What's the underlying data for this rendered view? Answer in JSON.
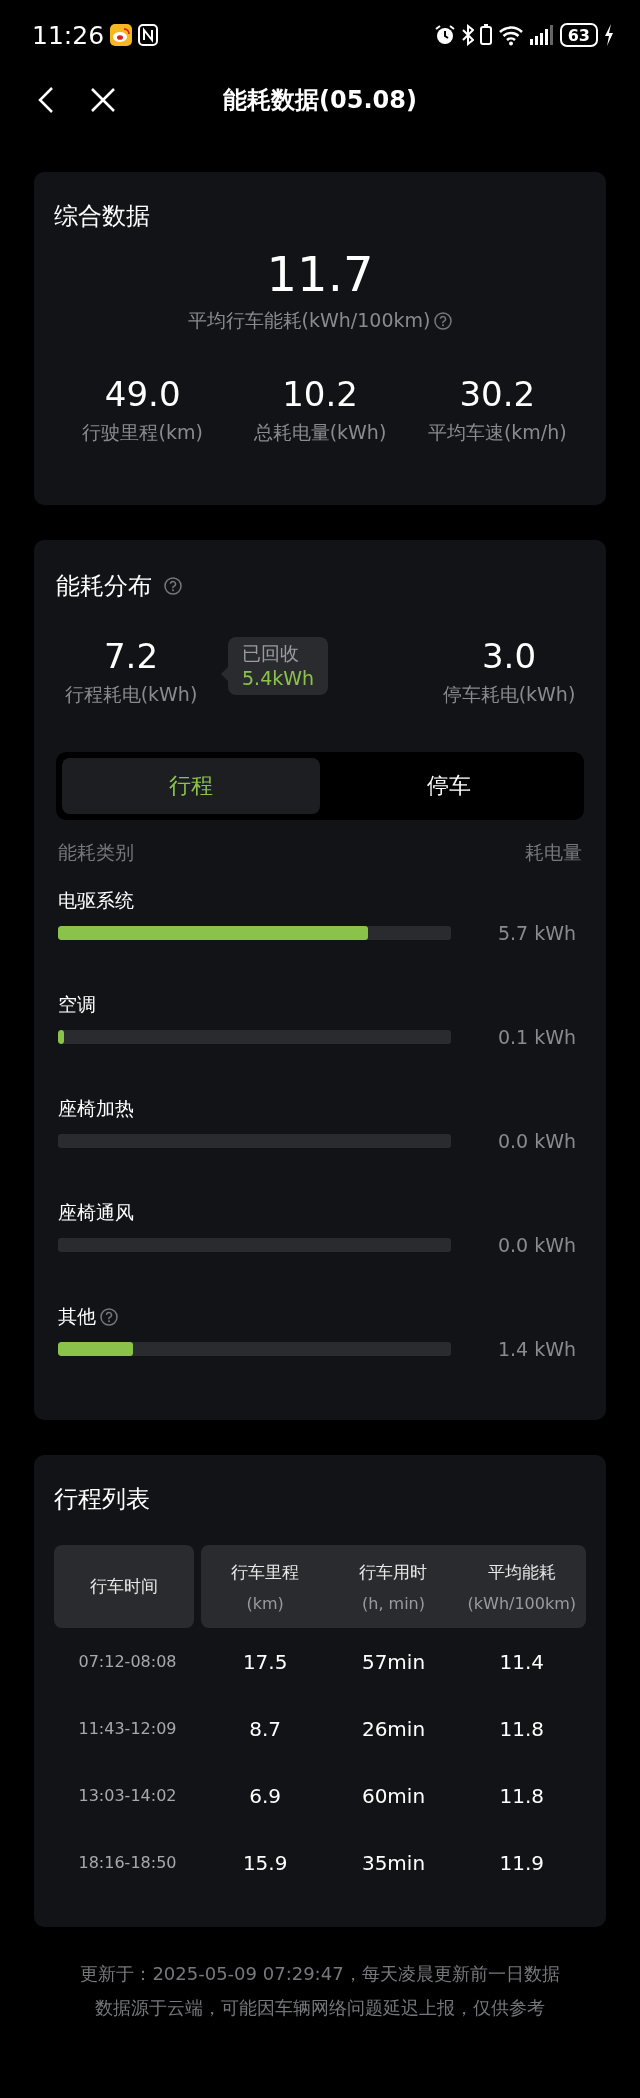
{
  "status_bar": {
    "time": "11:26",
    "battery": "63"
  },
  "nav": {
    "title": "能耗数据(05.08)"
  },
  "summary": {
    "title": "综合数据",
    "main_value": "11.7",
    "main_label": "平均行车能耗(kWh/100km)",
    "stats": [
      {
        "value": "49.0",
        "label": "行驶里程(km)"
      },
      {
        "value": "10.2",
        "label": "总耗电量(kWh)"
      },
      {
        "value": "30.2",
        "label": "平均车速(km/h)"
      }
    ]
  },
  "distribution": {
    "title": "能耗分布",
    "trip": {
      "value": "7.2",
      "label": "行程耗电(kWh)"
    },
    "recovered": {
      "label": "已回收",
      "value": "5.4kWh"
    },
    "parking": {
      "value": "3.0",
      "label": "停车耗电(kWh)"
    },
    "tabs": [
      {
        "label": "行程",
        "selected": true
      },
      {
        "label": "停车",
        "selected": false
      }
    ],
    "columns": [
      "能耗类别",
      "耗电量"
    ],
    "categories": [
      {
        "name": "电驱系统",
        "help": false,
        "level": 0.79,
        "reading": "5.7 kWh"
      },
      {
        "name": "空调",
        "help": false,
        "level": 0.015,
        "reading": "0.1 kWh"
      },
      {
        "name": "座椅加热",
        "help": false,
        "level": 0,
        "reading": "0.0 kWh"
      },
      {
        "name": "座椅通风",
        "help": false,
        "level": 0,
        "reading": "0.0 kWh"
      },
      {
        "name": "其他",
        "help": true,
        "level": 0.19,
        "reading": "1.4 kWh"
      }
    ]
  },
  "trips": {
    "title": "行程列表",
    "columns": [
      {
        "name": "行车时间"
      },
      {
        "name": "行车里程",
        "unit": "(km)"
      },
      {
        "name": "行车用时",
        "unit": "(h, min)"
      },
      {
        "name": "平均能耗",
        "unit": "(kWh/100km)"
      }
    ],
    "rows": [
      [
        "07:12-08:08",
        "17.5",
        "57min",
        "11.4"
      ],
      [
        "11:43-12:09",
        "8.7",
        "26min",
        "11.8"
      ],
      [
        "13:03-14:02",
        "6.9",
        "60min",
        "11.8"
      ],
      [
        "18:16-18:50",
        "15.9",
        "35min",
        "11.9"
      ]
    ]
  },
  "footer": [
    "更新于：2025-05-09 07:29:47，每天凌晨更新前一日数据",
    "数据源于云端，可能因车辆网络问题延迟上报，仅供参考"
  ]
}
